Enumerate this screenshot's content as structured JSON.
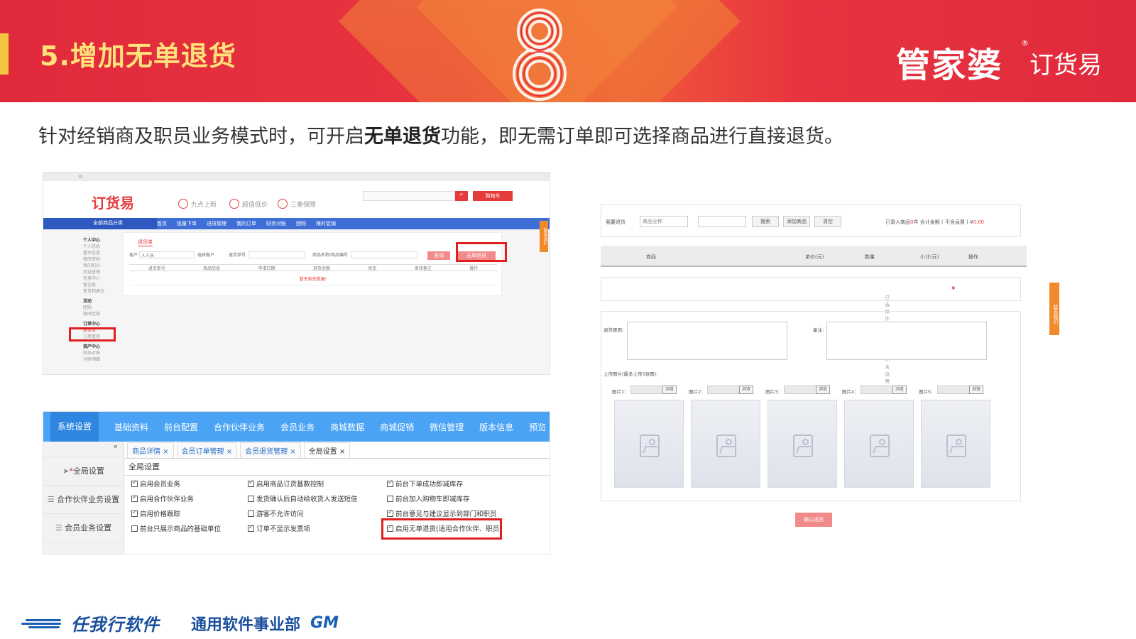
{
  "slide": {
    "title": "5.增加无单退货",
    "intro_before": "针对经销商及职员业务模式时，可开启",
    "intro_bold": "无单退货",
    "intro_after": "功能，即无需订单即可选择商品进行直接退货。"
  },
  "logo": {
    "brand": "管家婆",
    "reg": "®",
    "sub": "订货易"
  },
  "colors": {
    "banner": "#e02a3c",
    "title": "#ffe27a",
    "accent": "#e63b3b",
    "menu_blue": "#4aa3f5",
    "footer_blue": "#1a4f9e"
  },
  "mall": {
    "logo": "订货易",
    "promos": [
      "九点上新",
      "超值低价",
      "三重保障"
    ],
    "cart_label": "购物车",
    "nav_category": "全部商品分类",
    "nav_items": [
      "首页",
      "批量下单",
      "进货管理",
      "我的订单",
      "财务对账",
      "团购",
      "限时促销"
    ],
    "sidebar_groups": [
      {
        "title": "个人中心",
        "items": [
          "个人信息",
          "基本信息",
          "修改密码",
          "我的积分",
          "地址管理",
          "信息中心",
          "留言板",
          "意见和建议"
        ]
      },
      {
        "title": "活动",
        "items": [
          "团购",
          "限时促销"
        ]
      },
      {
        "title": "订单中心",
        "items": [
          "退货单",
          "订单管理"
        ]
      },
      {
        "title": "资产中心",
        "items": [
          "财务对账",
          "对账明细"
        ]
      }
    ],
    "tab_label": "退货单",
    "customer_label": "客户",
    "customer_value": "人人乐",
    "select_customer": "选择客户",
    "return_no_label": "退货单号",
    "product_label": "商品名称/商品编号",
    "search_btn": "查询",
    "no_order_return_btn": "无单退货",
    "table_headers": [
      "退货单号",
      "商品信息",
      "申请日期",
      "退货金额",
      "状态",
      "审核备注",
      "操作"
    ],
    "empty_text": "暂无相关数据!",
    "float_label": "联系我们"
  },
  "settings": {
    "menu": [
      "系统设置",
      "基础资料",
      "前台配置",
      "合作伙伴业务",
      "会员业务",
      "商城数据",
      "商城促销",
      "微信管理",
      "版本信息",
      "预览"
    ],
    "collapse": "«",
    "sidebar": [
      "全局设置",
      "合作伙伴业务设置",
      "会员业务设置"
    ],
    "tabs": [
      "商品详情",
      "会员订单管理",
      "会员退货管理",
      "全局设置"
    ],
    "section_title": "全局设置",
    "options": [
      {
        "label": "启用会员业务",
        "checked": true
      },
      {
        "label": "启用合作伙伴业务",
        "checked": true
      },
      {
        "label": "启用价格跟踪",
        "checked": true
      },
      {
        "label": "前台只展示商品的基础单位",
        "checked": false
      },
      {
        "label": "启用商品订货基数控制",
        "checked": true
      },
      {
        "label": "发货确认后自动给收货人发送短信",
        "checked": false
      },
      {
        "label": "游客不允许访问",
        "checked": false
      },
      {
        "label": "订单不显示发票项",
        "checked": true
      },
      {
        "label": "前台下单成功即减库存",
        "checked": true
      },
      {
        "label": "前台加入购物车即减库存",
        "checked": false
      },
      {
        "label": "前台意见与建议显示到部门和职员",
        "checked": true
      },
      {
        "label": "启用无单退货(适用合作伙伴、职员)",
        "checked": true
      }
    ]
  },
  "return_form": {
    "label": "我要退货",
    "product_placeholder": "商品全称",
    "search_btn": "搜索",
    "add_btn": "添加商品",
    "clear_btn": "清空",
    "summary_pre": "已录入商品",
    "summary_count": "0",
    "summary_mid": "件 合计金额 ( 不含运费 ) ¥",
    "summary_amount": "0.00",
    "headers": [
      "商品",
      "单价(元)",
      "数量",
      "小计(元)",
      "操作"
    ],
    "total_text": "已选择  件商品   总价 ( 不含运费 ) :",
    "total_yen": "¥",
    "reason_label": "退货原因：",
    "remark_label": "备注：",
    "upload_label": "上传图片(最多上传5张图)：",
    "images": [
      "图片1：",
      "图片2：",
      "图片3：",
      "图片4：",
      "图片5："
    ],
    "browse": "浏览",
    "confirm_btn": "确认退货",
    "float_label": "联系我们"
  },
  "footer": {
    "brand": "任我行软件",
    "dept": "通用软件事业部",
    "mark": "GM"
  }
}
